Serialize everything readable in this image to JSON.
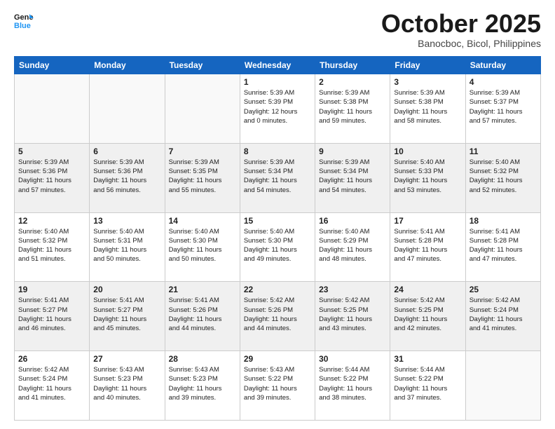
{
  "header": {
    "logo_line1": "General",
    "logo_line2": "Blue",
    "month": "October 2025",
    "location": "Banocboc, Bicol, Philippines"
  },
  "days_of_week": [
    "Sunday",
    "Monday",
    "Tuesday",
    "Wednesday",
    "Thursday",
    "Friday",
    "Saturday"
  ],
  "weeks": [
    [
      {
        "day": "",
        "info": ""
      },
      {
        "day": "",
        "info": ""
      },
      {
        "day": "",
        "info": ""
      },
      {
        "day": "1",
        "info": "Sunrise: 5:39 AM\nSunset: 5:39 PM\nDaylight: 12 hours\nand 0 minutes."
      },
      {
        "day": "2",
        "info": "Sunrise: 5:39 AM\nSunset: 5:38 PM\nDaylight: 11 hours\nand 59 minutes."
      },
      {
        "day": "3",
        "info": "Sunrise: 5:39 AM\nSunset: 5:38 PM\nDaylight: 11 hours\nand 58 minutes."
      },
      {
        "day": "4",
        "info": "Sunrise: 5:39 AM\nSunset: 5:37 PM\nDaylight: 11 hours\nand 57 minutes."
      }
    ],
    [
      {
        "day": "5",
        "info": "Sunrise: 5:39 AM\nSunset: 5:36 PM\nDaylight: 11 hours\nand 57 minutes."
      },
      {
        "day": "6",
        "info": "Sunrise: 5:39 AM\nSunset: 5:36 PM\nDaylight: 11 hours\nand 56 minutes."
      },
      {
        "day": "7",
        "info": "Sunrise: 5:39 AM\nSunset: 5:35 PM\nDaylight: 11 hours\nand 55 minutes."
      },
      {
        "day": "8",
        "info": "Sunrise: 5:39 AM\nSunset: 5:34 PM\nDaylight: 11 hours\nand 54 minutes."
      },
      {
        "day": "9",
        "info": "Sunrise: 5:39 AM\nSunset: 5:34 PM\nDaylight: 11 hours\nand 54 minutes."
      },
      {
        "day": "10",
        "info": "Sunrise: 5:40 AM\nSunset: 5:33 PM\nDaylight: 11 hours\nand 53 minutes."
      },
      {
        "day": "11",
        "info": "Sunrise: 5:40 AM\nSunset: 5:32 PM\nDaylight: 11 hours\nand 52 minutes."
      }
    ],
    [
      {
        "day": "12",
        "info": "Sunrise: 5:40 AM\nSunset: 5:32 PM\nDaylight: 11 hours\nand 51 minutes."
      },
      {
        "day": "13",
        "info": "Sunrise: 5:40 AM\nSunset: 5:31 PM\nDaylight: 11 hours\nand 50 minutes."
      },
      {
        "day": "14",
        "info": "Sunrise: 5:40 AM\nSunset: 5:30 PM\nDaylight: 11 hours\nand 50 minutes."
      },
      {
        "day": "15",
        "info": "Sunrise: 5:40 AM\nSunset: 5:30 PM\nDaylight: 11 hours\nand 49 minutes."
      },
      {
        "day": "16",
        "info": "Sunrise: 5:40 AM\nSunset: 5:29 PM\nDaylight: 11 hours\nand 48 minutes."
      },
      {
        "day": "17",
        "info": "Sunrise: 5:41 AM\nSunset: 5:28 PM\nDaylight: 11 hours\nand 47 minutes."
      },
      {
        "day": "18",
        "info": "Sunrise: 5:41 AM\nSunset: 5:28 PM\nDaylight: 11 hours\nand 47 minutes."
      }
    ],
    [
      {
        "day": "19",
        "info": "Sunrise: 5:41 AM\nSunset: 5:27 PM\nDaylight: 11 hours\nand 46 minutes."
      },
      {
        "day": "20",
        "info": "Sunrise: 5:41 AM\nSunset: 5:27 PM\nDaylight: 11 hours\nand 45 minutes."
      },
      {
        "day": "21",
        "info": "Sunrise: 5:41 AM\nSunset: 5:26 PM\nDaylight: 11 hours\nand 44 minutes."
      },
      {
        "day": "22",
        "info": "Sunrise: 5:42 AM\nSunset: 5:26 PM\nDaylight: 11 hours\nand 44 minutes."
      },
      {
        "day": "23",
        "info": "Sunrise: 5:42 AM\nSunset: 5:25 PM\nDaylight: 11 hours\nand 43 minutes."
      },
      {
        "day": "24",
        "info": "Sunrise: 5:42 AM\nSunset: 5:25 PM\nDaylight: 11 hours\nand 42 minutes."
      },
      {
        "day": "25",
        "info": "Sunrise: 5:42 AM\nSunset: 5:24 PM\nDaylight: 11 hours\nand 41 minutes."
      }
    ],
    [
      {
        "day": "26",
        "info": "Sunrise: 5:42 AM\nSunset: 5:24 PM\nDaylight: 11 hours\nand 41 minutes."
      },
      {
        "day": "27",
        "info": "Sunrise: 5:43 AM\nSunset: 5:23 PM\nDaylight: 11 hours\nand 40 minutes."
      },
      {
        "day": "28",
        "info": "Sunrise: 5:43 AM\nSunset: 5:23 PM\nDaylight: 11 hours\nand 39 minutes."
      },
      {
        "day": "29",
        "info": "Sunrise: 5:43 AM\nSunset: 5:22 PM\nDaylight: 11 hours\nand 39 minutes."
      },
      {
        "day": "30",
        "info": "Sunrise: 5:44 AM\nSunset: 5:22 PM\nDaylight: 11 hours\nand 38 minutes."
      },
      {
        "day": "31",
        "info": "Sunrise: 5:44 AM\nSunset: 5:22 PM\nDaylight: 11 hours\nand 37 minutes."
      },
      {
        "day": "",
        "info": ""
      }
    ]
  ]
}
